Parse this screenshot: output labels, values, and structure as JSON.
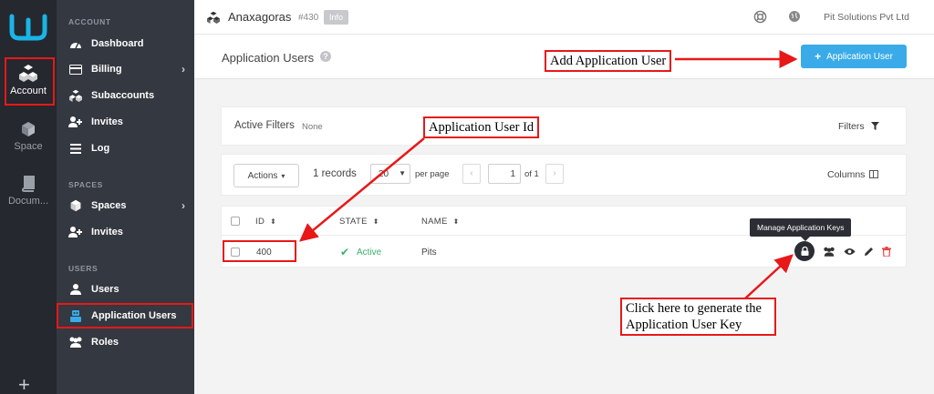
{
  "rail": {
    "items": [
      {
        "label": "Account",
        "icon": "cubes-icon"
      },
      {
        "label": "Space",
        "icon": "cube-icon"
      },
      {
        "label": "Docum...",
        "icon": "book-icon"
      }
    ],
    "add_icon": "+"
  },
  "nav": {
    "sections": {
      "account": "ACCOUNT",
      "spaces": "SPACES",
      "users": "USERS"
    },
    "account_items": [
      {
        "label": "Dashboard"
      },
      {
        "label": "Billing"
      },
      {
        "label": "Subaccounts"
      },
      {
        "label": "Invites"
      },
      {
        "label": "Log"
      }
    ],
    "spaces_items": [
      {
        "label": "Spaces"
      },
      {
        "label": "Invites"
      }
    ],
    "users_items": [
      {
        "label": "Users"
      },
      {
        "label": "Application Users"
      },
      {
        "label": "Roles"
      }
    ]
  },
  "topbar": {
    "title": "Anaxagoras",
    "id": "#430",
    "badge": "Info",
    "org": "Pit Solutions Pvt Ltd"
  },
  "header": {
    "title": "Application Users",
    "help": "?",
    "add_button": "Application User"
  },
  "filters": {
    "label": "Active Filters",
    "value": "None",
    "button": "Filters"
  },
  "toolbar": {
    "actions": "Actions",
    "records": "1 records",
    "per_page_value": "20",
    "per_page_label": "per page",
    "prev": "‹",
    "page": "1",
    "of": "of 1",
    "next": "›",
    "columns": "Columns"
  },
  "table": {
    "headers": {
      "id": "ID",
      "state": "STATE",
      "name": "NAME"
    },
    "rows": [
      {
        "id": "400",
        "state": "Active",
        "name": "Pits"
      }
    ]
  },
  "tooltip": "Manage Application Keys",
  "annotations": {
    "add_user": "Add Application User",
    "user_id": "Application User Id",
    "generate_line1": "Click here to generate the",
    "generate_line2": "Application User Key"
  },
  "colors": {
    "primary": "#3aabe8",
    "active": "#3bb06a",
    "annotation": "#e81818",
    "rail": "#25282e",
    "nav": "#343840"
  }
}
